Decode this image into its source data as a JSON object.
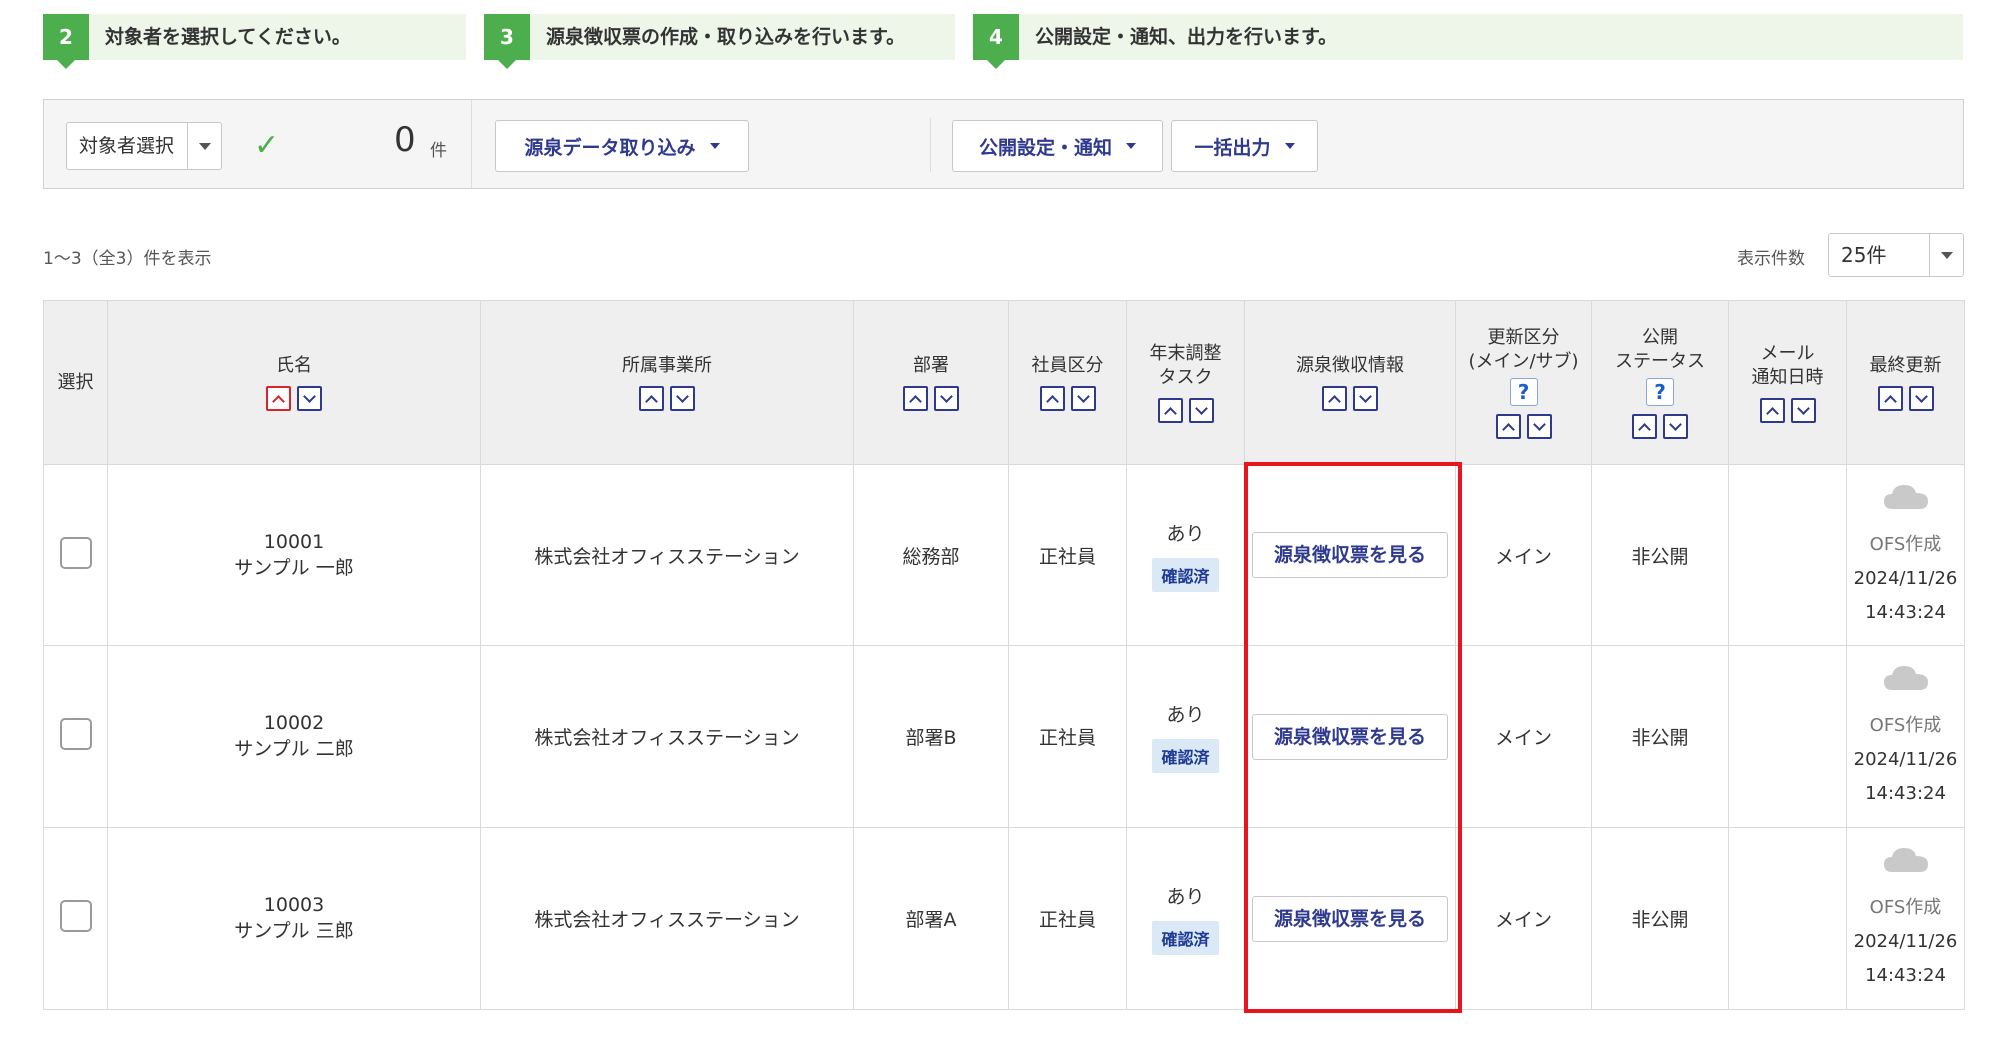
{
  "steps": [
    {
      "num": "2",
      "text": "対象者を選択してください。"
    },
    {
      "num": "3",
      "text": "源泉徴収票の作成・取り込みを行います。"
    },
    {
      "num": "4",
      "text": "公開設定・通知、出力を行います。"
    }
  ],
  "toolbar": {
    "target_select": "対象者選択",
    "check_icon": "✓",
    "count": "0",
    "count_unit": "件",
    "import_button": "源泉データ取り込み",
    "publish_button": "公開設定・通知",
    "bulk_output_button": "一括出力"
  },
  "list": {
    "range_text": "1〜3（全3）件を表示",
    "per_page_label": "表示件数",
    "per_page_value": "25件"
  },
  "table": {
    "headers": {
      "select": "選択",
      "name": "氏名",
      "office": "所属事業所",
      "dept": "部署",
      "emp_type": "社員区分",
      "yearend_1": "年末調整",
      "yearend_2": "タスク",
      "withholding": "源泉徴収情報",
      "update_1": "更新区分",
      "update_2": "(メイン/サブ)",
      "status_1": "公開",
      "status_2": "ステータス",
      "mail_1": "メール",
      "mail_2": "通知日時",
      "last_update": "最終更新",
      "help": "?"
    },
    "rows": [
      {
        "id": "10001",
        "name": "サンプル 一郎",
        "office": "株式会社オフィスステーション",
        "dept": "総務部",
        "emp_type": "正社員",
        "task": "あり",
        "task_badge": "確認済",
        "view_button": "源泉徴収票を見る",
        "update_type": "メイン",
        "status": "非公開",
        "mail": "",
        "upd_by": "OFS作成",
        "upd_date": "2024/11/26",
        "upd_time": "14:43:24"
      },
      {
        "id": "10002",
        "name": "サンプル 二郎",
        "office": "株式会社オフィスステーション",
        "dept": "部署B",
        "emp_type": "正社員",
        "task": "あり",
        "task_badge": "確認済",
        "view_button": "源泉徴収票を見る",
        "update_type": "メイン",
        "status": "非公開",
        "mail": "",
        "upd_by": "OFS作成",
        "upd_date": "2024/11/26",
        "upd_time": "14:43:24"
      },
      {
        "id": "10003",
        "name": "サンプル 三郎",
        "office": "株式会社オフィスステーション",
        "dept": "部署A",
        "emp_type": "正社員",
        "task": "あり",
        "task_badge": "確認済",
        "view_button": "源泉徴収票を見る",
        "update_type": "メイン",
        "status": "非公開",
        "mail": "",
        "upd_by": "OFS作成",
        "upd_date": "2024/11/26",
        "upd_time": "14:43:24"
      }
    ]
  },
  "colors": {
    "step_green": "#4cae4c",
    "step_bg": "#eef6ea",
    "link_blue": "#2f3a8f",
    "highlight_red": "#e8141e",
    "badge_bg": "#dbe9f7"
  }
}
